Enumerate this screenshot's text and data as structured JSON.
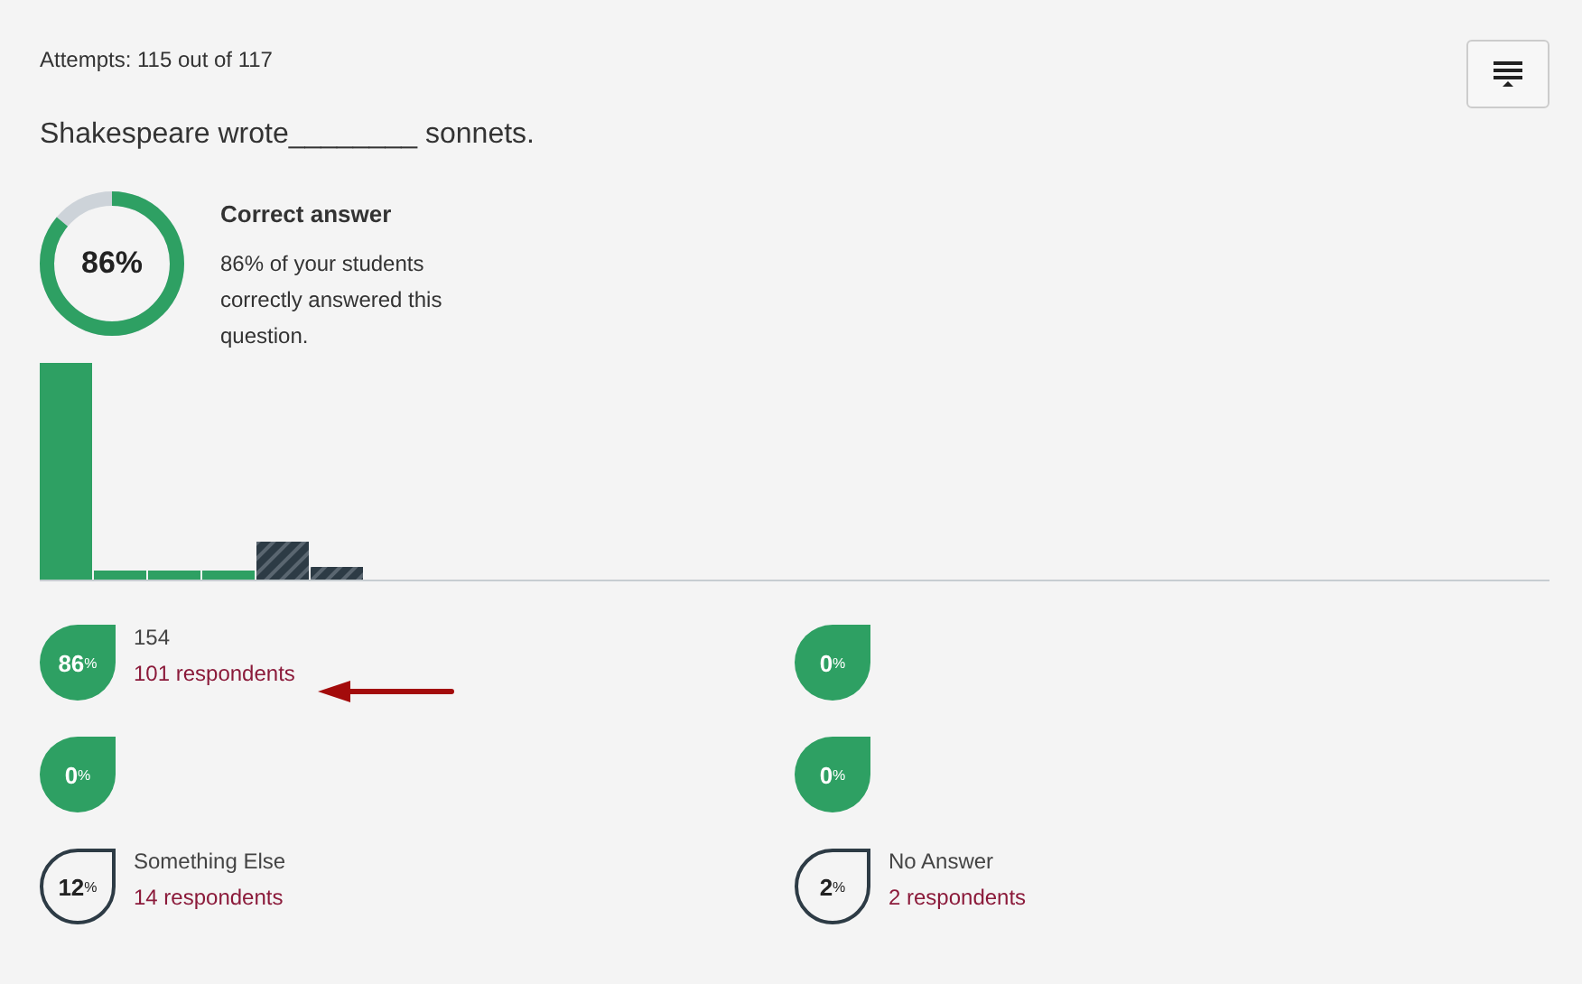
{
  "attempts": "Attempts: 115 out of 117",
  "question": "Shakespeare wrote________ sonnets.",
  "score": {
    "level": 0.86,
    "text": "86%",
    "title": "Correct answer",
    "description": "86% of your students correctly answered this question."
  },
  "answers": [
    {
      "kind": "correct",
      "percent": "86",
      "unit": "%",
      "label": "154",
      "respondents": "101 respondents"
    },
    {
      "kind": "correct",
      "percent": "0",
      "unit": "%"
    },
    {
      "kind": "correct",
      "percent": "0",
      "unit": "%"
    },
    {
      "kind": "correct",
      "percent": "0",
      "unit": "%"
    },
    {
      "kind": "other",
      "percent": "12",
      "unit": "%",
      "label": "Something Else",
      "respondents": "14 respondents"
    },
    {
      "kind": "other",
      "percent": "2",
      "unit": "%",
      "label": "No Answer",
      "respondents": "2 respondents"
    }
  ]
}
